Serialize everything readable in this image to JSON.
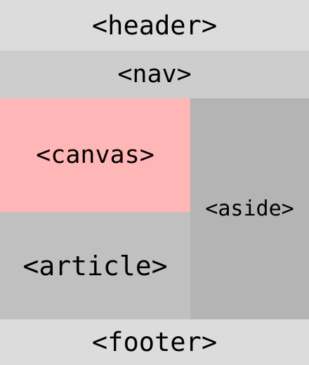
{
  "blocks": {
    "header": {
      "label": "<header>",
      "color": "#dcdcdc"
    },
    "nav": {
      "label": "<nav>",
      "color": "#cdcdcd"
    },
    "canvas": {
      "label": "<canvas>",
      "color": "#ffb6b6"
    },
    "article": {
      "label": "<article>",
      "color": "#c0c0c0"
    },
    "aside": {
      "label": "<aside>",
      "color": "#b4b4b4"
    },
    "footer": {
      "label": "<footer>",
      "color": "#dcdcdc"
    }
  }
}
